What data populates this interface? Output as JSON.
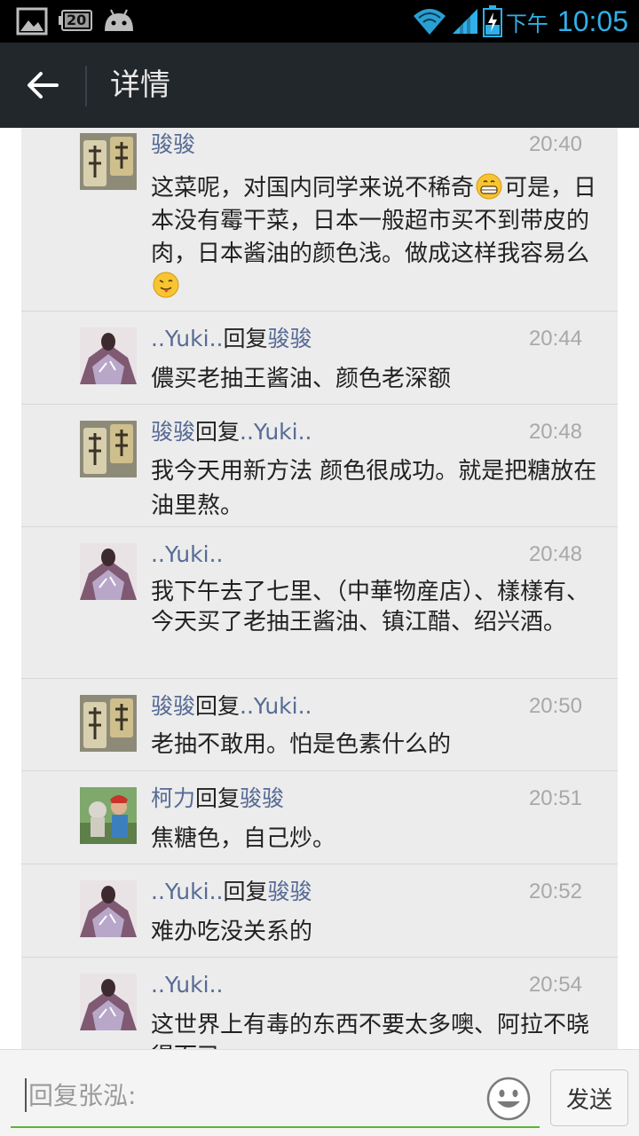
{
  "status_bar": {
    "battery_text": "20",
    "ampm": "下午",
    "time": "10:05"
  },
  "header": {
    "title": "详情"
  },
  "comments": [
    {
      "name": "骏骏",
      "reply_word": "",
      "reply_to": "",
      "time": "20:40",
      "text_parts": [
        "这菜呢，对国内同学来说不稀奇",
        "可是，日本没有霉干菜，日本一般超市买不到带皮的肉，日本酱油的颜色浅。做成这样我容易么",
        ""
      ]
    },
    {
      "name": "..Yuki..",
      "reply_word": "回复",
      "reply_to": "骏骏",
      "time": "20:44",
      "text": "儂买老抽王酱油、颜色老深额"
    },
    {
      "name": "骏骏",
      "reply_word": "回复",
      "reply_to": "..Yuki..",
      "time": "20:48",
      "text": "我今天用新方法 颜色很成功。就是把糖放在油里熬。"
    },
    {
      "name": "..Yuki..",
      "reply_word": "",
      "reply_to": "",
      "time": "20:48",
      "text": "我下午去了七里、（中華物産店）、樣樣有、今天买了老抽王酱油、镇江醋、绍兴酒。"
    },
    {
      "name": "骏骏",
      "reply_word": "回复",
      "reply_to": "..Yuki..",
      "time": "20:50",
      "text": "老抽不敢用。怕是色素什么的"
    },
    {
      "name": "柯力",
      "reply_word": "回复",
      "reply_to": "骏骏",
      "time": "20:51",
      "text": "焦糖色，自己炒。"
    },
    {
      "name": "..Yuki..",
      "reply_word": "回复",
      "reply_to": "骏骏",
      "time": "20:52",
      "text": "难办吃没关系的"
    },
    {
      "name": "..Yuki..",
      "reply_word": "",
      "reply_to": "",
      "time": "20:54",
      "text": "这世界上有毒的东西不要太多噢、阿拉不晓得而已"
    }
  ],
  "reply_bar": {
    "placeholder": "回复张泓:",
    "send_label": "发送"
  },
  "colors": {
    "name": "#576b95",
    "input_underline": "#5fb336",
    "action_bar": "#22272b",
    "status_accent": "#2fb0e8"
  },
  "icons": [
    "image-icon",
    "battery-icon",
    "android-icon",
    "wifi-icon",
    "signal-icon",
    "charging-battery-icon",
    "back-arrow-icon",
    "grin-emoji-icon",
    "tongue-emoji-icon",
    "smiley-emoji-icon"
  ]
}
